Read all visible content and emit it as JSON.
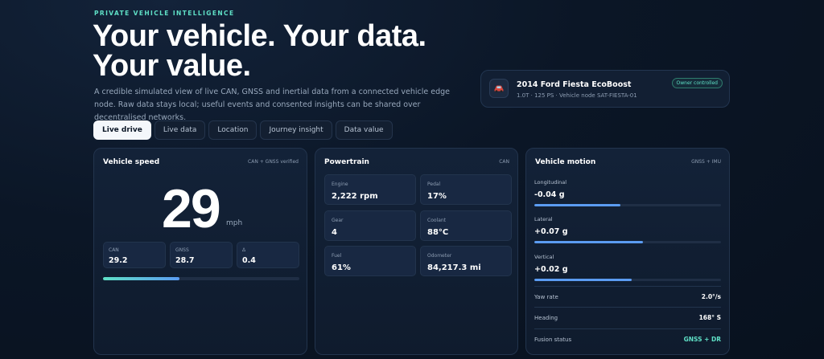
{
  "header": {
    "eyebrow": "PRIVATE VEHICLE INTELLIGENCE",
    "hero_line1": "Your vehicle. Your data.",
    "hero_line2": "Your value.",
    "lede": "A credible simulated view of live CAN, GNSS and inertial data from a connected vehicle edge node. Raw data stays local; useful events and consented insights can be shared over decentralised networks."
  },
  "vehicle": {
    "icon": "car-icon",
    "name": "2014 Ford Fiesta EcoBoost",
    "sub": "1.0T · 125 PS · Vehicle node SAT-FIESTA-01",
    "badge": "Owner controlled"
  },
  "tabs": [
    {
      "label": "Live drive",
      "active": true
    },
    {
      "label": "Live data",
      "active": false
    },
    {
      "label": "Location",
      "active": false
    },
    {
      "label": "Journey insight",
      "active": false
    },
    {
      "label": "Data value",
      "active": false
    }
  ],
  "speed": {
    "title": "Vehicle speed",
    "tag": "CAN + GNSS verified",
    "value": "29",
    "unit": "mph",
    "cells": [
      {
        "label": "CAN",
        "value": "29.2"
      },
      {
        "label": "GNSS",
        "value": "28.7"
      },
      {
        "label": "Δ",
        "value": "0.4"
      }
    ],
    "bar_fraction": 0.39,
    "colors": {
      "bar_start": "#5fe0c6",
      "bar_end": "#5b9cf2"
    }
  },
  "powertrain": {
    "title": "Powertrain",
    "tag": "CAN",
    "tiles": [
      {
        "label": "Engine",
        "value": "2,222 rpm"
      },
      {
        "label": "Pedal",
        "value": "17%"
      },
      {
        "label": "Gear",
        "value": "4"
      },
      {
        "label": "Coolant",
        "value": "88°C"
      },
      {
        "label": "Fuel",
        "value": "61%"
      },
      {
        "label": "Odometer",
        "value": "84,217.3 mi"
      }
    ]
  },
  "motion": {
    "title": "Vehicle motion",
    "tag": "GNSS + IMU",
    "metrics": [
      {
        "label": "Longitudinal",
        "value": "-0.04 g",
        "fraction": 0.46
      },
      {
        "label": "Lateral",
        "value": "+0.07 g",
        "fraction": 0.58
      },
      {
        "label": "Vertical",
        "value": "+0.02 g",
        "fraction": 0.52
      }
    ],
    "rows": [
      {
        "key": "Yaw rate",
        "value": "2.0°/s"
      },
      {
        "key": "Heading",
        "value": "168° S"
      },
      {
        "key": "Fusion status",
        "value": "GNSS + DR"
      }
    ],
    "colors": {
      "accent": "#5fe0c6",
      "bar": "#5b9cf2"
    }
  }
}
